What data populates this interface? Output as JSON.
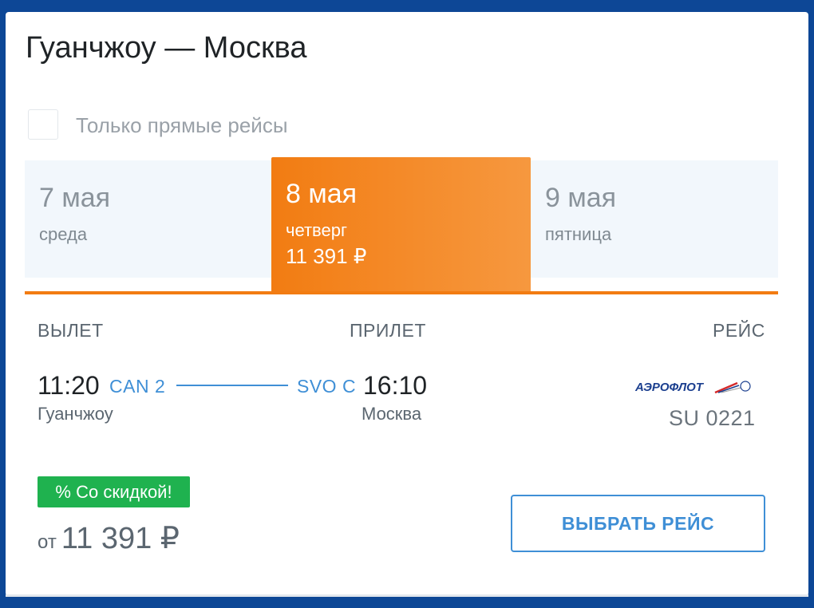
{
  "route": {
    "title": "Гуанчжоу — Москва"
  },
  "filter": {
    "direct_only_label": "Только прямые рейсы",
    "checked": false
  },
  "dates": [
    {
      "date": "7 мая",
      "day": "среда",
      "price": ""
    },
    {
      "date": "8 мая",
      "day": "четверг",
      "price": "11 391 ₽",
      "active": true
    },
    {
      "date": "9 мая",
      "day": "пятница",
      "price": ""
    }
  ],
  "columns": {
    "departure": "ВЫЛЕТ",
    "arrival": "ПРИЛЕТ",
    "flight": "РЕЙС"
  },
  "flight": {
    "dep_time": "11:20",
    "dep_code": "CAN 2",
    "dep_city": "Гуанчжоу",
    "arr_code": "SVO C",
    "arr_time": "16:10",
    "arr_city": "Москва",
    "airline_logo_text": "АЭРОФЛОТ",
    "number": "SU 0221"
  },
  "offer": {
    "badge": "% Со скидкой!",
    "price_prefix": "от",
    "price": "11 391 ₽",
    "select_label": "ВЫБРАТЬ РЕЙС"
  },
  "colors": {
    "accent_orange": "#f27c12",
    "accent_blue": "#3f8fd6",
    "discount_green": "#1fb24f",
    "frame_blue": "#0d4796"
  },
  "icons": {
    "checkbox": "checkbox-icon",
    "airline": "aeroflot-logo"
  }
}
